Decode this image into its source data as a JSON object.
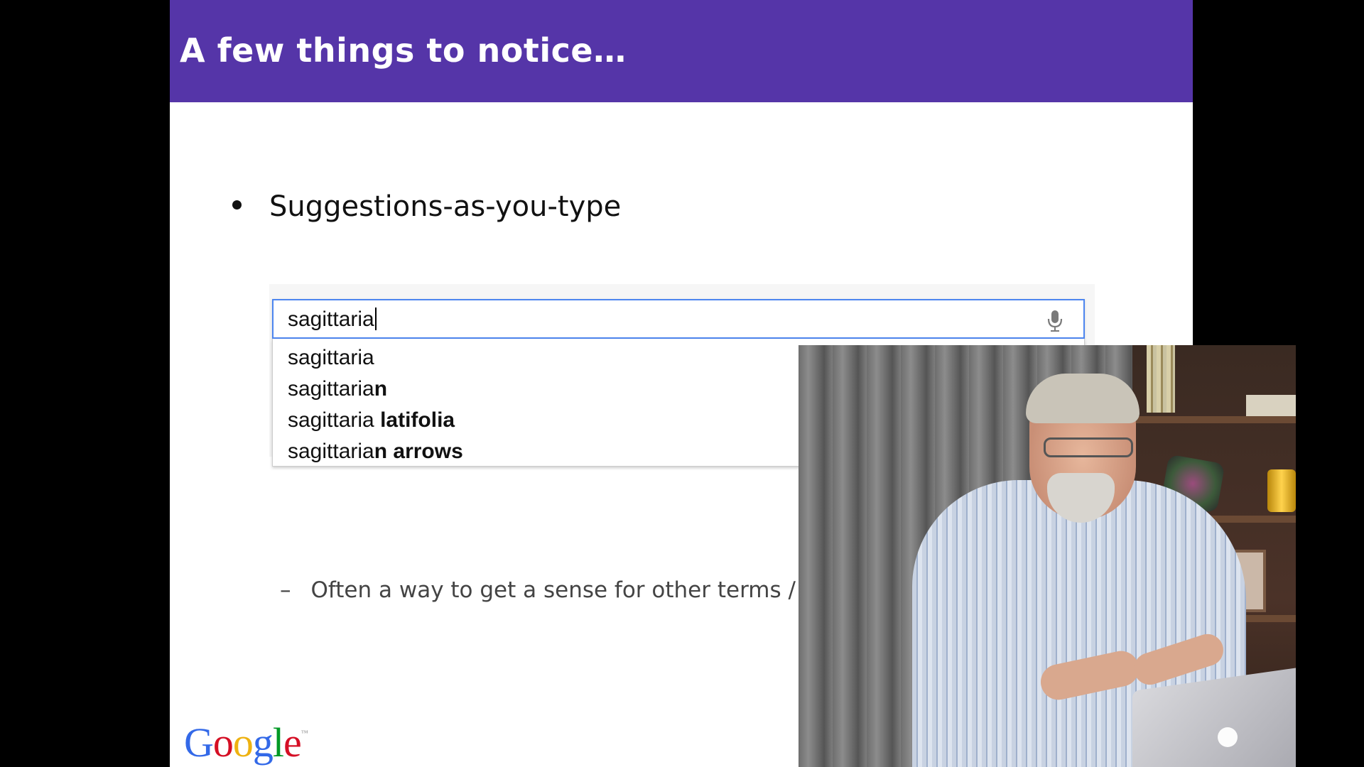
{
  "slide": {
    "title": "A few things to notice…",
    "bullet": "Suggestions-as-you-type",
    "search": {
      "value": "sagittaria",
      "mic_icon": "microphone-icon"
    },
    "suggestions": [
      {
        "prefix": "sagittaria",
        "suffix": ""
      },
      {
        "prefix": "sagittaria",
        "suffix": "n"
      },
      {
        "prefix": "sagittaria ",
        "suffix": "latifolia"
      },
      {
        "prefix": "sagittaria",
        "suffix": "n arrows"
      }
    ],
    "sub_bullet_dash": "–",
    "sub_bullet": "Often a way to get a sense for other terms / co",
    "logo": "Google",
    "colors": {
      "title_bar": "#5535a8",
      "search_focus": "#4d86f0"
    }
  },
  "video": {
    "description_icon": "presenter-video"
  }
}
